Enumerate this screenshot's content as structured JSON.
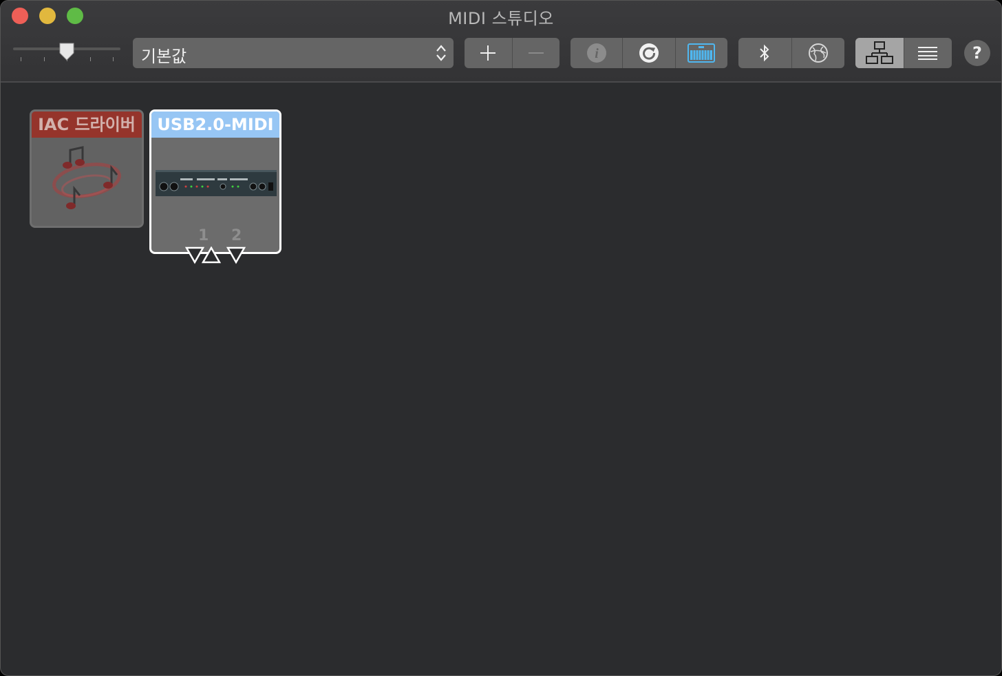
{
  "window": {
    "title": "MIDI 스튜디오"
  },
  "toolbar": {
    "configuration": "기본값",
    "help_label": "?"
  },
  "devices": [
    {
      "name": "IAC 드라이버",
      "color": "#a8362b"
    },
    {
      "name": "USB2.0-MIDI",
      "color": "#97c6f4",
      "ports": [
        "1",
        "2"
      ]
    }
  ],
  "colors": {
    "accent_keyboard": "#4fb7f0"
  }
}
